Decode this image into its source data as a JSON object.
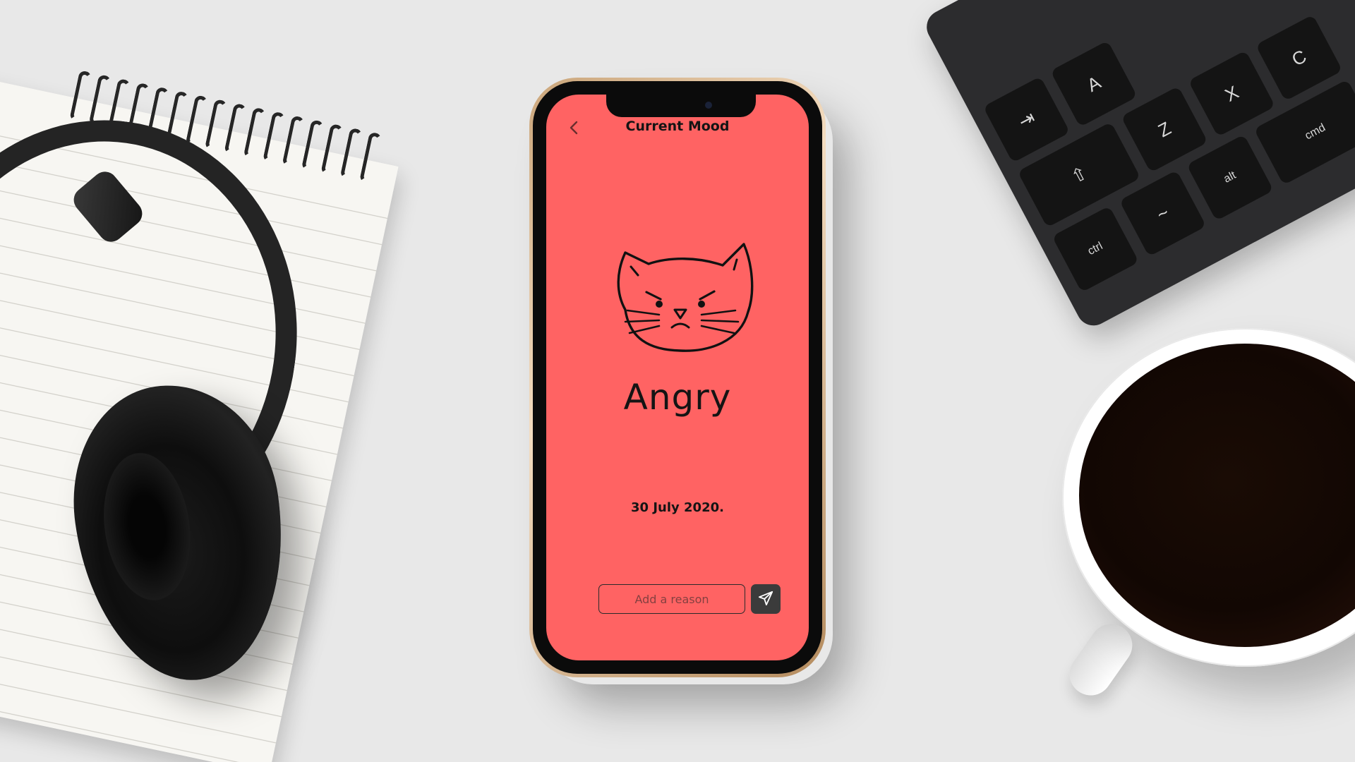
{
  "app": {
    "title": "Current Mood",
    "background_color": "#ff6363",
    "accent_dark": "#3b3b3b"
  },
  "header": {
    "back_icon": "chevron-left-icon",
    "title": "Current Mood"
  },
  "mood": {
    "illustration": "angry-cat-icon",
    "label": "Angry",
    "date": "30 July 2020."
  },
  "reason": {
    "placeholder": "Add a reason",
    "value": "",
    "send_icon": "paper-plane-icon"
  },
  "keyboard": {
    "keys": [
      "⇥",
      "A",
      "Z",
      "X",
      "C",
      "⇧",
      "ctrl",
      "alt",
      "cmd",
      "⌘",
      "⌥",
      "~",
      "^"
    ]
  }
}
